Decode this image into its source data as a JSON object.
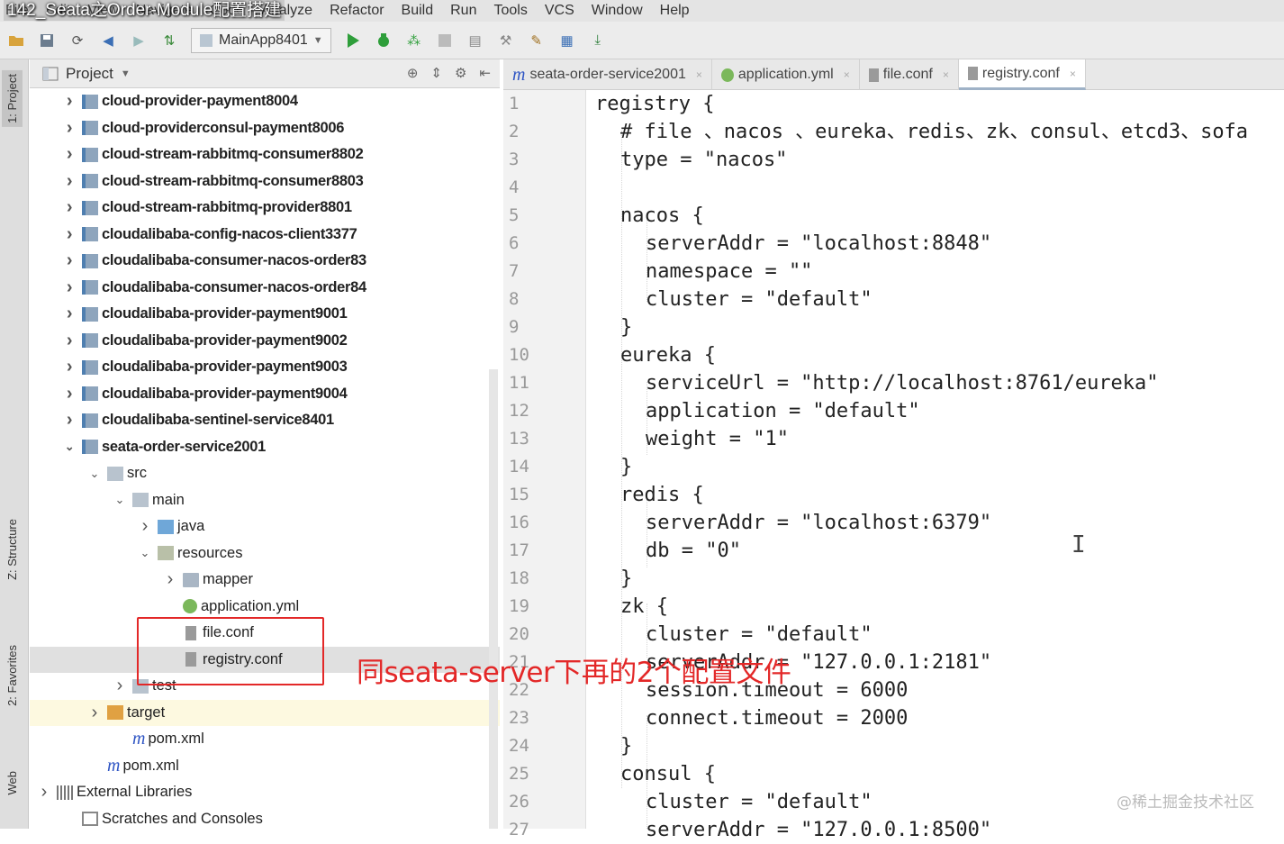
{
  "video_title": "142_Seata之Order-Module配置搭建",
  "menu": [
    "File",
    "Edit",
    "View",
    "Navigate",
    "Code",
    "Analyze",
    "Refactor",
    "Build",
    "Run",
    "Tools",
    "VCS",
    "Window",
    "Help"
  ],
  "toolbar": {
    "run_config": "MainApp8401"
  },
  "side_tabs": {
    "project": "1: Project",
    "structure": "Z: Structure",
    "favorites": "2: Favorites",
    "web": "Web"
  },
  "project_panel": {
    "title": "Project"
  },
  "tree": [
    {
      "label": "cloud-provider-payment8004",
      "indent": 1,
      "arrow": ">",
      "icon": "mod",
      "bold": true
    },
    {
      "label": "cloud-providerconsul-payment8006",
      "indent": 1,
      "arrow": ">",
      "icon": "mod",
      "bold": true
    },
    {
      "label": "cloud-stream-rabbitmq-consumer8802",
      "indent": 1,
      "arrow": ">",
      "icon": "mod",
      "bold": true
    },
    {
      "label": "cloud-stream-rabbitmq-consumer8803",
      "indent": 1,
      "arrow": ">",
      "icon": "mod",
      "bold": true
    },
    {
      "label": "cloud-stream-rabbitmq-provider8801",
      "indent": 1,
      "arrow": ">",
      "icon": "mod",
      "bold": true
    },
    {
      "label": "cloudalibaba-config-nacos-client3377",
      "indent": 1,
      "arrow": ">",
      "icon": "mod",
      "bold": true
    },
    {
      "label": "cloudalibaba-consumer-nacos-order83",
      "indent": 1,
      "arrow": ">",
      "icon": "mod",
      "bold": true
    },
    {
      "label": "cloudalibaba-consumer-nacos-order84",
      "indent": 1,
      "arrow": ">",
      "icon": "mod",
      "bold": true
    },
    {
      "label": "cloudalibaba-provider-payment9001",
      "indent": 1,
      "arrow": ">",
      "icon": "mod",
      "bold": true
    },
    {
      "label": "cloudalibaba-provider-payment9002",
      "indent": 1,
      "arrow": ">",
      "icon": "mod",
      "bold": true
    },
    {
      "label": "cloudalibaba-provider-payment9003",
      "indent": 1,
      "arrow": ">",
      "icon": "mod",
      "bold": true
    },
    {
      "label": "cloudalibaba-provider-payment9004",
      "indent": 1,
      "arrow": ">",
      "icon": "mod",
      "bold": true
    },
    {
      "label": "cloudalibaba-sentinel-service8401",
      "indent": 1,
      "arrow": ">",
      "icon": "mod",
      "bold": true
    },
    {
      "label": "seata-order-service2001",
      "indent": 1,
      "arrow": "v",
      "icon": "mod",
      "bold": true
    },
    {
      "label": "src",
      "indent": 2,
      "arrow": "v",
      "icon": "src",
      "bold": false
    },
    {
      "label": "main",
      "indent": 3,
      "arrow": "v",
      "icon": "src",
      "bold": false
    },
    {
      "label": "java",
      "indent": 4,
      "arrow": ">",
      "icon": "java",
      "bold": false
    },
    {
      "label": "resources",
      "indent": 4,
      "arrow": "v",
      "icon": "res",
      "bold": false
    },
    {
      "label": "mapper",
      "indent": 5,
      "arrow": ">",
      "icon": "fold",
      "bold": false
    },
    {
      "label": "application.yml",
      "indent": 5,
      "arrow": "",
      "icon": "yml",
      "bold": false
    },
    {
      "label": "file.conf",
      "indent": 5,
      "arrow": "",
      "icon": "file",
      "bold": false
    },
    {
      "label": "registry.conf",
      "indent": 5,
      "arrow": "",
      "icon": "file",
      "bold": false,
      "state": "selected"
    },
    {
      "label": "test",
      "indent": 3,
      "arrow": ">",
      "icon": "src",
      "bold": false
    },
    {
      "label": "target",
      "indent": 2,
      "arrow": ">",
      "icon": "target",
      "bold": false,
      "state": "excluded"
    },
    {
      "label": "pom.xml",
      "indent": 3,
      "arrow": "",
      "icon": "m",
      "bold": false
    },
    {
      "label": "pom.xml",
      "indent": 2,
      "arrow": "",
      "icon": "m",
      "bold": false
    },
    {
      "label": "External Libraries",
      "indent": 0,
      "arrow": ">",
      "icon": "lib",
      "bold": false
    },
    {
      "label": "Scratches and Consoles",
      "indent": 1,
      "arrow": "",
      "icon": "scr",
      "bold": false
    }
  ],
  "tabs": [
    {
      "label": "seata-order-service2001",
      "icon": "m",
      "active": false
    },
    {
      "label": "application.yml",
      "icon": "yml",
      "active": false
    },
    {
      "label": "file.conf",
      "icon": "conf",
      "active": false
    },
    {
      "label": "registry.conf",
      "icon": "conf",
      "active": true
    }
  ],
  "code_lines": [
    {
      "n": "1",
      "indent": 0,
      "text": "registry {"
    },
    {
      "n": "2",
      "indent": 1,
      "text": "# file 、nacos 、eureka、redis、zk、consul、etcd3、sofa"
    },
    {
      "n": "3",
      "indent": 1,
      "text": "type = \"nacos\""
    },
    {
      "n": "4",
      "indent": 0,
      "text": ""
    },
    {
      "n": "5",
      "indent": 1,
      "text": "nacos {"
    },
    {
      "n": "6",
      "indent": 2,
      "text": "serverAddr = \"localhost:8848\""
    },
    {
      "n": "7",
      "indent": 2,
      "text": "namespace = \"\""
    },
    {
      "n": "8",
      "indent": 2,
      "text": "cluster = \"default\""
    },
    {
      "n": "9",
      "indent": 1,
      "text": "}"
    },
    {
      "n": "10",
      "indent": 1,
      "text": "eureka {"
    },
    {
      "n": "11",
      "indent": 2,
      "text": "serviceUrl = \"http://localhost:8761/eureka\""
    },
    {
      "n": "12",
      "indent": 2,
      "text": "application = \"default\""
    },
    {
      "n": "13",
      "indent": 2,
      "text": "weight = \"1\""
    },
    {
      "n": "14",
      "indent": 1,
      "text": "}"
    },
    {
      "n": "15",
      "indent": 1,
      "text": "redis {"
    },
    {
      "n": "16",
      "indent": 2,
      "text": "serverAddr = \"localhost:6379\""
    },
    {
      "n": "17",
      "indent": 2,
      "text": "db = \"0\""
    },
    {
      "n": "18",
      "indent": 1,
      "text": "}"
    },
    {
      "n": "19",
      "indent": 1,
      "text": "zk {"
    },
    {
      "n": "20",
      "indent": 2,
      "text": "cluster = \"default\""
    },
    {
      "n": "21",
      "indent": 2,
      "text": "serverAddr = \"127.0.0.1:2181\""
    },
    {
      "n": "22",
      "indent": 2,
      "text": "session.timeout = 6000"
    },
    {
      "n": "23",
      "indent": 2,
      "text": "connect.timeout = 2000"
    },
    {
      "n": "24",
      "indent": 1,
      "text": "}"
    },
    {
      "n": "25",
      "indent": 1,
      "text": "consul {"
    },
    {
      "n": "26",
      "indent": 2,
      "text": "cluster = \"default\""
    },
    {
      "n": "27",
      "indent": 2,
      "text": "serverAddr = \"127.0.0.1:8500\""
    }
  ],
  "annotation": "同seata-server下再的2个配置文件",
  "watermark": "@稀土掘金技术社区",
  "colors": {
    "annotation_red": "#e32828",
    "accent_blue": "#2f55c4",
    "run_green": "#2e9e3a"
  }
}
